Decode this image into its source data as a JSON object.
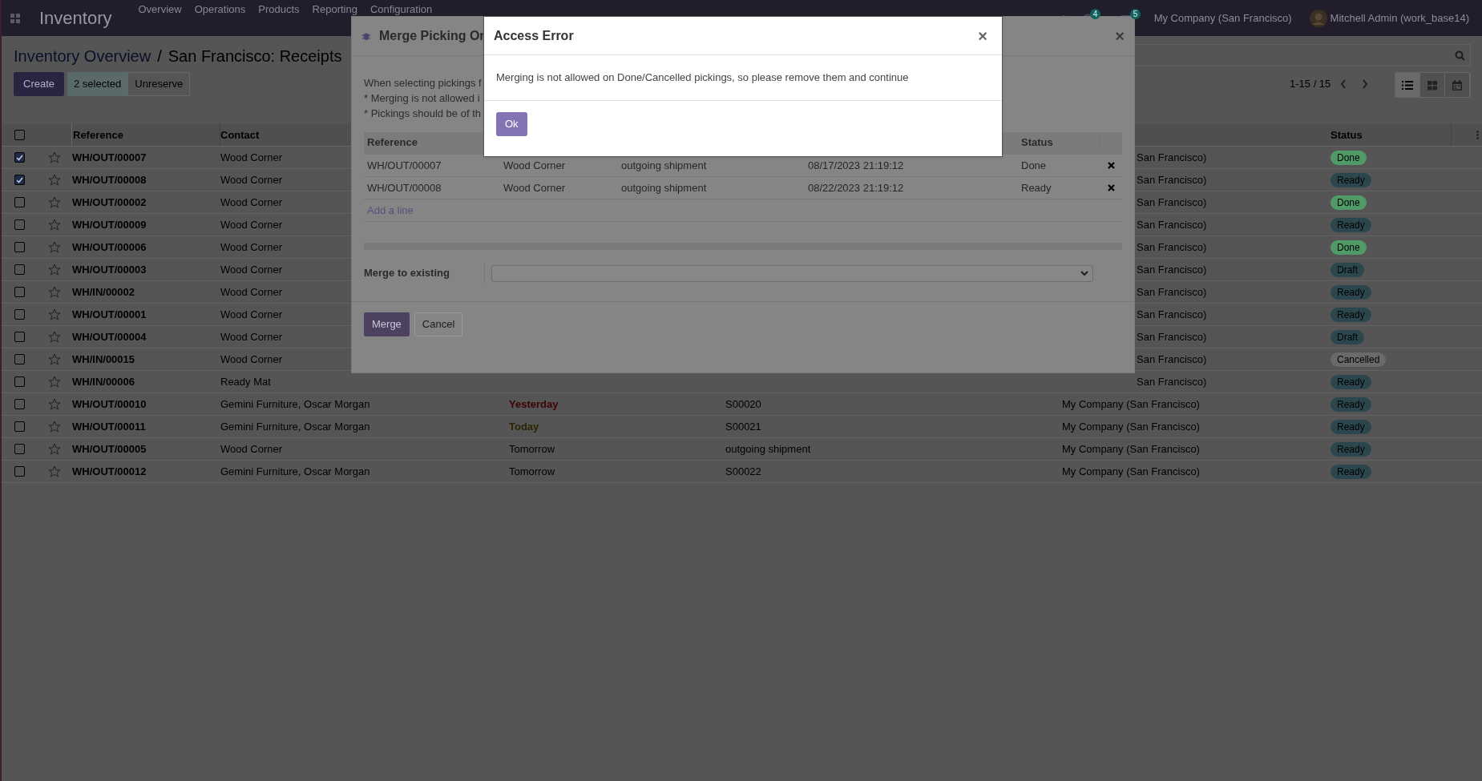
{
  "navbar": {
    "app": "Inventory",
    "menu": [
      "Overview",
      "Operations",
      "Products",
      "Reporting",
      "Configuration"
    ],
    "activity_count": "4",
    "message_count": "5",
    "company": "My Company (San Francisco)",
    "user": "Mitchell Admin (work_base14)"
  },
  "breadcrumb": [
    "Inventory Overview",
    "San Francisco: Receipts"
  ],
  "breadcrumb_separator": "/",
  "toolbar": {
    "create": "Create",
    "selected_count": "2 selected",
    "unreserve": "Unreserve",
    "pager": "1-15 / 15"
  },
  "views": [
    {
      "kind": "list",
      "selected": true
    },
    {
      "kind": "kanban",
      "selected": false
    },
    {
      "kind": "calendar",
      "selected": false
    }
  ],
  "table": {
    "all_selected": false,
    "columns": [
      "Reference",
      "Contact",
      "Status"
    ],
    "rows": [
      {
        "checked": true,
        "reference": "WH/OUT/00007",
        "contact": "Wood Corner",
        "company": "San Francisco)",
        "status": "Done",
        "color": "#4f9a66"
      },
      {
        "checked": true,
        "reference": "WH/OUT/00008",
        "contact": "Wood Corner",
        "company": "San Francisco)",
        "status": "Ready",
        "color": "#2b474d"
      },
      {
        "checked": false,
        "reference": "WH/OUT/00002",
        "contact": "Wood Corner",
        "company": "San Francisco)",
        "status": "Done",
        "color": "#4f9a66"
      },
      {
        "checked": false,
        "reference": "WH/OUT/00009",
        "contact": "Wood Corner",
        "company": "San Francisco)",
        "status": "Ready",
        "color": "#2b474d"
      },
      {
        "checked": false,
        "reference": "WH/OUT/00006",
        "contact": "Wood Corner",
        "company": "San Francisco)",
        "status": "Done",
        "color": "#4f9a66"
      },
      {
        "checked": false,
        "reference": "WH/OUT/00003",
        "contact": "Wood Corner",
        "company": "San Francisco)",
        "status": "Draft",
        "color": "#2b474d"
      },
      {
        "checked": false,
        "reference": "WH/IN/00002",
        "contact": "Wood Corner",
        "company": "San Francisco)",
        "status": "Ready",
        "color": "#2b474d"
      },
      {
        "checked": false,
        "reference": "WH/OUT/00001",
        "contact": "Wood Corner",
        "company": "San Francisco)",
        "status": "Ready",
        "color": "#2b474d"
      },
      {
        "checked": false,
        "reference": "WH/OUT/00004",
        "contact": "Wood Corner",
        "company": "San Francisco)",
        "status": "Draft",
        "color": "#2b474d"
      },
      {
        "checked": false,
        "reference": "WH/IN/00015",
        "contact": "Wood Corner",
        "company": "San Francisco)",
        "status": "Cancelled",
        "color": "#6a6a6a"
      },
      {
        "checked": false,
        "reference": "WH/IN/00006",
        "contact": "Ready Mat",
        "company": "San Francisco)",
        "status": "Ready",
        "color": "#2b474d"
      },
      {
        "checked": false,
        "reference": "WH/OUT/00010",
        "contact": "Gemini Furniture, Oscar Morgan",
        "scheduled": {
          "text": "Yesterday",
          "kind": "overdue"
        },
        "source": "S00020",
        "company": "My Company (San Francisco)",
        "status": "Ready",
        "color": "#2b474d"
      },
      {
        "checked": false,
        "reference": "WH/OUT/00011",
        "contact": "Gemini Furniture, Oscar Morgan",
        "scheduled": {
          "text": "Today",
          "kind": "today"
        },
        "source": "S00021",
        "company": "My Company (San Francisco)",
        "status": "Ready",
        "color": "#2b474d"
      },
      {
        "checked": false,
        "reference": "WH/OUT/00005",
        "contact": "Wood Corner",
        "scheduled": {
          "text": "Tomorrow",
          "kind": "future"
        },
        "source": "outgoing shipment",
        "company": "My Company (San Francisco)",
        "status": "Ready",
        "color": "#2b474d"
      },
      {
        "checked": false,
        "reference": "WH/OUT/00012",
        "contact": "Gemini Furniture, Oscar Morgan",
        "scheduled": {
          "text": "Tomorrow",
          "kind": "future"
        },
        "source": "S00022",
        "company": "My Company (San Francisco)",
        "status": "Ready",
        "color": "#2b474d"
      }
    ]
  },
  "merge_dialog": {
    "title": "Merge Picking Or",
    "intro": [
      "When selecting pickings f",
      "* Merging is not allowed i",
      "* Pickings should be of th"
    ],
    "columns": [
      "Reference",
      "Status"
    ],
    "rows": [
      {
        "reference": "WH/OUT/00007",
        "contact": "Wood Corner",
        "source": "outgoing shipment",
        "date": "08/17/2023 21:19:12",
        "status": "Done"
      },
      {
        "reference": "WH/OUT/00008",
        "contact": "Wood Corner",
        "source": "outgoing shipment",
        "date": "08/22/2023 21:19:12",
        "status": "Ready"
      }
    ],
    "add_line": "Add a line",
    "field_label": "Merge to existing",
    "buttons": [
      "Merge",
      "Cancel"
    ]
  },
  "error_dialog": {
    "title": "Access Error",
    "close": "×",
    "message": "Merging is not allowed on Done/Cancelled pickings, so please remove them and continue",
    "button": "Ok"
  }
}
